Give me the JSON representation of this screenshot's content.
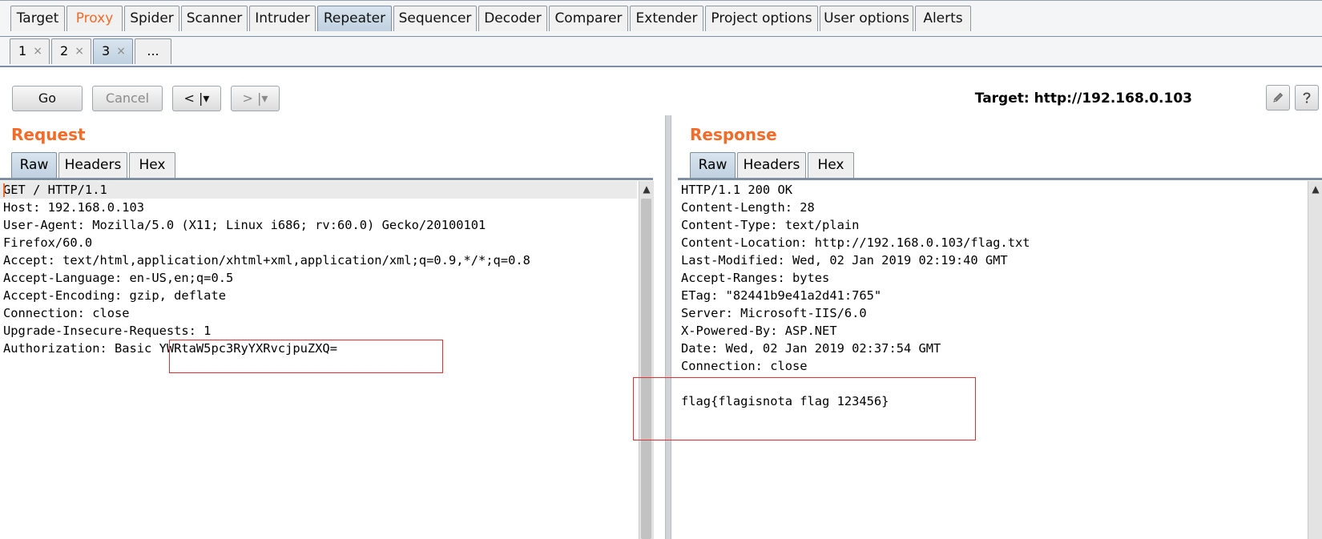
{
  "main_tabs": [
    {
      "label": "Target"
    },
    {
      "label": "Proxy"
    },
    {
      "label": "Spider"
    },
    {
      "label": "Scanner"
    },
    {
      "label": "Intruder"
    },
    {
      "label": "Repeater"
    },
    {
      "label": "Sequencer"
    },
    {
      "label": "Decoder"
    },
    {
      "label": "Comparer"
    },
    {
      "label": "Extender"
    },
    {
      "label": "Project options"
    },
    {
      "label": "User options"
    },
    {
      "label": "Alerts"
    }
  ],
  "selected_main_tab": "Repeater",
  "repeater_tabs": [
    {
      "label": "1",
      "close": "×"
    },
    {
      "label": "2",
      "close": "×"
    },
    {
      "label": "3",
      "close": "×"
    }
  ],
  "selected_repeater_tab": "3",
  "repeater_more_tab": "...",
  "toolbar": {
    "go_label": "Go",
    "cancel_label": "Cancel",
    "back_label": "< |▾",
    "forward_label": "> |▾",
    "target_text": "Target: http://192.168.0.103"
  },
  "request": {
    "title": "Request",
    "tabs": [
      {
        "label": "Raw"
      },
      {
        "label": "Headers"
      },
      {
        "label": "Hex"
      }
    ],
    "selected_tab": "Raw",
    "lines": [
      "GET / HTTP/1.1",
      "Host: 192.168.0.103",
      "User-Agent: Mozilla/5.0 (X11; Linux i686; rv:60.0) Gecko/20100101",
      "Firefox/60.0",
      "Accept: text/html,application/xhtml+xml,application/xml;q=0.9,*/*;q=0.8",
      "Accept-Language: en-US,en;q=0.5",
      "Accept-Encoding: gzip, deflate",
      "Connection: close",
      "Upgrade-Insecure-Requests: 1",
      "Authorization: Basic YWRtaW5pc3RyYXRvcjpuZXQ="
    ]
  },
  "response": {
    "title": "Response",
    "tabs": [
      {
        "label": "Raw"
      },
      {
        "label": "Headers"
      },
      {
        "label": "Hex"
      }
    ],
    "selected_tab": "Raw",
    "lines": [
      "HTTP/1.1 200 OK",
      "Content-Length: 28",
      "Content-Type: text/plain",
      "Content-Location: http://192.168.0.103/flag.txt",
      "Last-Modified: Wed, 02 Jan 2019 02:19:40 GMT",
      "Accept-Ranges: bytes",
      "ETag: \"82441b9e41a2d41:765\"",
      "Server: Microsoft-IIS/6.0",
      "X-Powered-By: ASP.NET",
      "Date: Wed, 02 Jan 2019 02:37:54 GMT",
      "Connection: close",
      "",
      "flag{flagisnota flag 123456}"
    ]
  },
  "colors": {
    "accent": "#f26b28",
    "highlight_box": "#e5302f",
    "selected_tab": "#c7d6e4"
  },
  "icons": {
    "edit_target": "pencil-icon",
    "help": "help-icon",
    "scroll_up": "scroll-up-arrow-icon"
  }
}
